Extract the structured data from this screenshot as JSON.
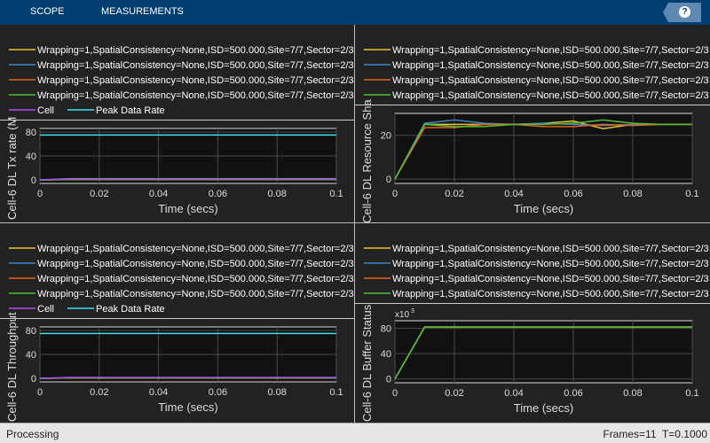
{
  "toolbar": {
    "tabs": [
      "SCOPE",
      "MEASUREMENTS"
    ],
    "help_label": "?"
  },
  "status": {
    "left": "Processing",
    "frames": "Frames=11",
    "time": "T=0.1000"
  },
  "colors": {
    "toolbar": "#003e72",
    "plot_bg": "#111111",
    "panel_bg": "#222222"
  },
  "chart_data": [
    {
      "type": "line",
      "ylabel": "Cell-6 DL Tx rate (M",
      "xlabel": "Time (secs)",
      "xlim": [
        0,
        0.1
      ],
      "ylim": [
        -6,
        86
      ],
      "yticks": [
        0,
        40,
        80
      ],
      "xticks": [
        "0",
        "0.02",
        "0.04",
        "0.06",
        "0.08",
        "0.1"
      ],
      "grid": true,
      "legend_placement": "top",
      "x": [
        0,
        0.01,
        0.02,
        0.03,
        0.04,
        0.05,
        0.06,
        0.07,
        0.08,
        0.09,
        0.1
      ],
      "series": [
        {
          "name": "Wrapping=1,SpatialConsistency=None,ISD=500.000,Site=7/7,Sector=2/3",
          "color": "#e8c52a",
          "values": [
            0,
            0.5,
            0.5,
            0.5,
            0.5,
            0.5,
            0.5,
            0.5,
            0.5,
            0.5,
            0.5
          ]
        },
        {
          "name": "Wrapping=1,SpatialConsistency=None,ISD=500.000,Site=7/7,Sector=2/3",
          "color": "#3a87c8",
          "values": [
            0,
            0.5,
            0.5,
            0.5,
            0.5,
            0.5,
            0.5,
            0.5,
            0.5,
            0.5,
            0.5
          ]
        },
        {
          "name": "Wrapping=1,SpatialConsistency=None,ISD=500.000,Site=7/7,Sector=2/3",
          "color": "#e2641a",
          "values": [
            0,
            0.5,
            0.5,
            0.5,
            0.5,
            0.5,
            0.5,
            0.5,
            0.5,
            0.5,
            0.5
          ]
        },
        {
          "name": "Wrapping=1,SpatialConsistency=None,ISD=500.000,Site=7/7,Sector=2/3",
          "color": "#4fbf3a",
          "values": [
            0,
            0.5,
            0.5,
            0.5,
            0.5,
            0.5,
            0.5,
            0.5,
            0.5,
            0.5,
            0.5
          ]
        },
        {
          "name": "Cell",
          "color": "#b04ef0",
          "values": [
            0,
            2,
            2,
            2,
            2,
            2,
            2,
            2,
            2,
            2,
            2
          ]
        },
        {
          "name": "Peak Data Rate",
          "color": "#40e0e8",
          "values": [
            75,
            75,
            75,
            75,
            75,
            75,
            75,
            75,
            75,
            75,
            75
          ]
        }
      ]
    },
    {
      "type": "line",
      "ylabel": "Cell-6 DL Resource Sha",
      "xlabel": "Time (secs)",
      "xlim": [
        0,
        0.1
      ],
      "ylim": [
        -2,
        30
      ],
      "yticks": [
        0,
        20
      ],
      "xticks": [
        "0",
        "0.02",
        "0.04",
        "0.06",
        "0.08",
        "0.1"
      ],
      "grid": true,
      "legend_placement": "top",
      "x": [
        0,
        0.01,
        0.02,
        0.03,
        0.04,
        0.05,
        0.06,
        0.07,
        0.08,
        0.09,
        0.1
      ],
      "series": [
        {
          "name": "Wrapping=1,SpatialConsistency=None,ISD=500.000,Site=7/7,Sector=2/3",
          "color": "#e8c52a",
          "values": [
            0,
            25,
            25,
            25,
            25,
            25.5,
            26.5,
            23,
            25,
            25,
            25
          ]
        },
        {
          "name": "Wrapping=1,SpatialConsistency=None,ISD=500.000,Site=7/7,Sector=2/3",
          "color": "#3a87c8",
          "values": [
            0,
            25.5,
            27,
            25.5,
            25,
            25.5,
            25,
            24.5,
            25,
            25,
            25
          ]
        },
        {
          "name": "Wrapping=1,SpatialConsistency=None,ISD=500.000,Site=7/7,Sector=2/3",
          "color": "#e2641a",
          "values": [
            0,
            23.5,
            23.5,
            25,
            25,
            24,
            24,
            25,
            24.5,
            25,
            25
          ]
        },
        {
          "name": "Wrapping=1,SpatialConsistency=None,ISD=500.000,Site=7/7,Sector=2/3",
          "color": "#4fbf3a",
          "values": [
            0,
            25,
            24,
            24,
            25,
            25,
            25.5,
            27,
            25.5,
            25,
            25
          ]
        }
      ]
    },
    {
      "type": "line",
      "ylabel": "Cell-6 DL Throughput",
      "xlabel": "Time (secs)",
      "xlim": [
        0,
        0.1
      ],
      "ylim": [
        -6,
        86
      ],
      "yticks": [
        0,
        40,
        80
      ],
      "xticks": [
        "0",
        "0.02",
        "0.04",
        "0.06",
        "0.08",
        "0.1"
      ],
      "grid": true,
      "legend_placement": "top",
      "x": [
        0,
        0.01,
        0.02,
        0.03,
        0.04,
        0.05,
        0.06,
        0.07,
        0.08,
        0.09,
        0.1
      ],
      "series": [
        {
          "name": "Wrapping=1,SpatialConsistency=None,ISD=500.000,Site=7/7,Sector=2/3",
          "color": "#e8c52a",
          "values": [
            0,
            0.5,
            0.5,
            0.5,
            0.5,
            0.5,
            0.5,
            0.5,
            0.5,
            0.5,
            0.5
          ]
        },
        {
          "name": "Wrapping=1,SpatialConsistency=None,ISD=500.000,Site=7/7,Sector=2/3",
          "color": "#3a87c8",
          "values": [
            0,
            0.5,
            0.5,
            0.5,
            0.5,
            0.5,
            0.5,
            0.5,
            0.5,
            0.5,
            0.5
          ]
        },
        {
          "name": "Wrapping=1,SpatialConsistency=None,ISD=500.000,Site=7/7,Sector=2/3",
          "color": "#e2641a",
          "values": [
            0,
            0.5,
            0.5,
            0.5,
            0.5,
            0.5,
            0.5,
            0.5,
            0.5,
            0.5,
            0.5
          ]
        },
        {
          "name": "Wrapping=1,SpatialConsistency=None,ISD=500.000,Site=7/7,Sector=2/3",
          "color": "#4fbf3a",
          "values": [
            0,
            0.5,
            0.5,
            0.5,
            0.5,
            0.5,
            0.5,
            0.5,
            0.5,
            0.5,
            0.5
          ]
        },
        {
          "name": "Cell",
          "color": "#b04ef0",
          "values": [
            0,
            1.5,
            1.5,
            1.5,
            1.5,
            1.5,
            1.5,
            1.5,
            1.5,
            1.5,
            1.5
          ]
        },
        {
          "name": "Peak Data Rate",
          "color": "#40e0e8",
          "values": [
            75,
            75,
            75,
            75,
            75,
            75,
            75,
            75,
            75,
            75,
            75
          ]
        }
      ]
    },
    {
      "type": "line",
      "ylabel": "Cell-6 DL Buffer Status",
      "xlabel": "Time (secs)",
      "y_multiplier": "x10",
      "y_multiplier_exp": "3",
      "xlim": [
        0,
        0.1
      ],
      "ylim": [
        -6,
        92
      ],
      "yticks": [
        0,
        40,
        80
      ],
      "xticks": [
        "0",
        "0.02",
        "0.04",
        "0.06",
        "0.08",
        "0.1"
      ],
      "grid": true,
      "legend_placement": "top",
      "x": [
        0,
        0.01,
        0.02,
        0.03,
        0.04,
        0.05,
        0.06,
        0.07,
        0.08,
        0.09,
        0.1
      ],
      "series": [
        {
          "name": "Wrapping=1,SpatialConsistency=None,ISD=500.000,Site=7/7,Sector=2/3",
          "color": "#e8c52a",
          "values": [
            0,
            82,
            82,
            82,
            82,
            82,
            82,
            82,
            82,
            82,
            82
          ]
        },
        {
          "name": "Wrapping=1,SpatialConsistency=None,ISD=500.000,Site=7/7,Sector=2/3",
          "color": "#3a87c8",
          "values": [
            0,
            82,
            82,
            82,
            82,
            82,
            82,
            82,
            82,
            82,
            82
          ]
        },
        {
          "name": "Wrapping=1,SpatialConsistency=None,ISD=500.000,Site=7/7,Sector=2/3",
          "color": "#e2641a",
          "values": [
            0,
            82,
            82,
            82,
            82,
            82,
            82,
            82,
            82,
            82,
            82
          ]
        },
        {
          "name": "Wrapping=1,SpatialConsistency=None,ISD=500.000,Site=7/7,Sector=2/3",
          "color": "#4fbf3a",
          "values": [
            0,
            82,
            82,
            82,
            82,
            82,
            82,
            82,
            82,
            82,
            82
          ]
        }
      ]
    }
  ]
}
